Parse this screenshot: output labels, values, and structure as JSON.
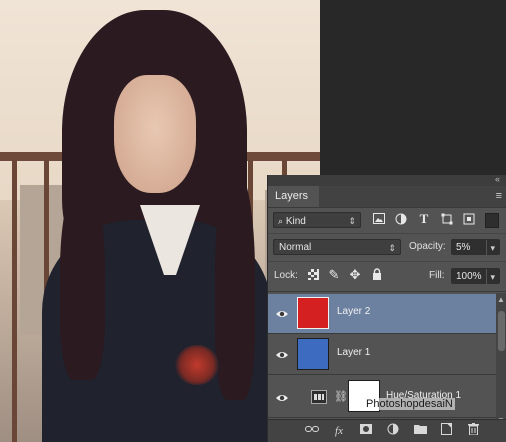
{
  "panel": {
    "tab_label": "Layers",
    "collapse_glyph": "«",
    "menu_glyph": "≡",
    "filter": {
      "value": "Kind",
      "icons": [
        "image-filter-icon",
        "adjustment-filter-icon",
        "type-filter-icon",
        "shape-filter-icon",
        "smart-object-filter-icon"
      ]
    },
    "blend_mode": "Normal",
    "opacity_label": "Opacity:",
    "opacity_value": "5%",
    "lock_label": "Lock:",
    "fill_label": "Fill:",
    "fill_value": "100%",
    "layers": [
      {
        "name": "Layer 2",
        "color": "#d42020",
        "selected": true
      },
      {
        "name": "Layer 1",
        "color": "#3c6bc0",
        "selected": false
      },
      {
        "name": "Hue/Saturation 1",
        "color": "#ffffff",
        "selected": false
      }
    ],
    "bottom_icons": [
      "link-layers-icon",
      "fx-icon",
      "add-mask-icon",
      "new-adjustment-icon",
      "new-group-icon",
      "new-layer-icon",
      "delete-layer-icon"
    ]
  },
  "watermark": "PhotoshopdesaiN"
}
